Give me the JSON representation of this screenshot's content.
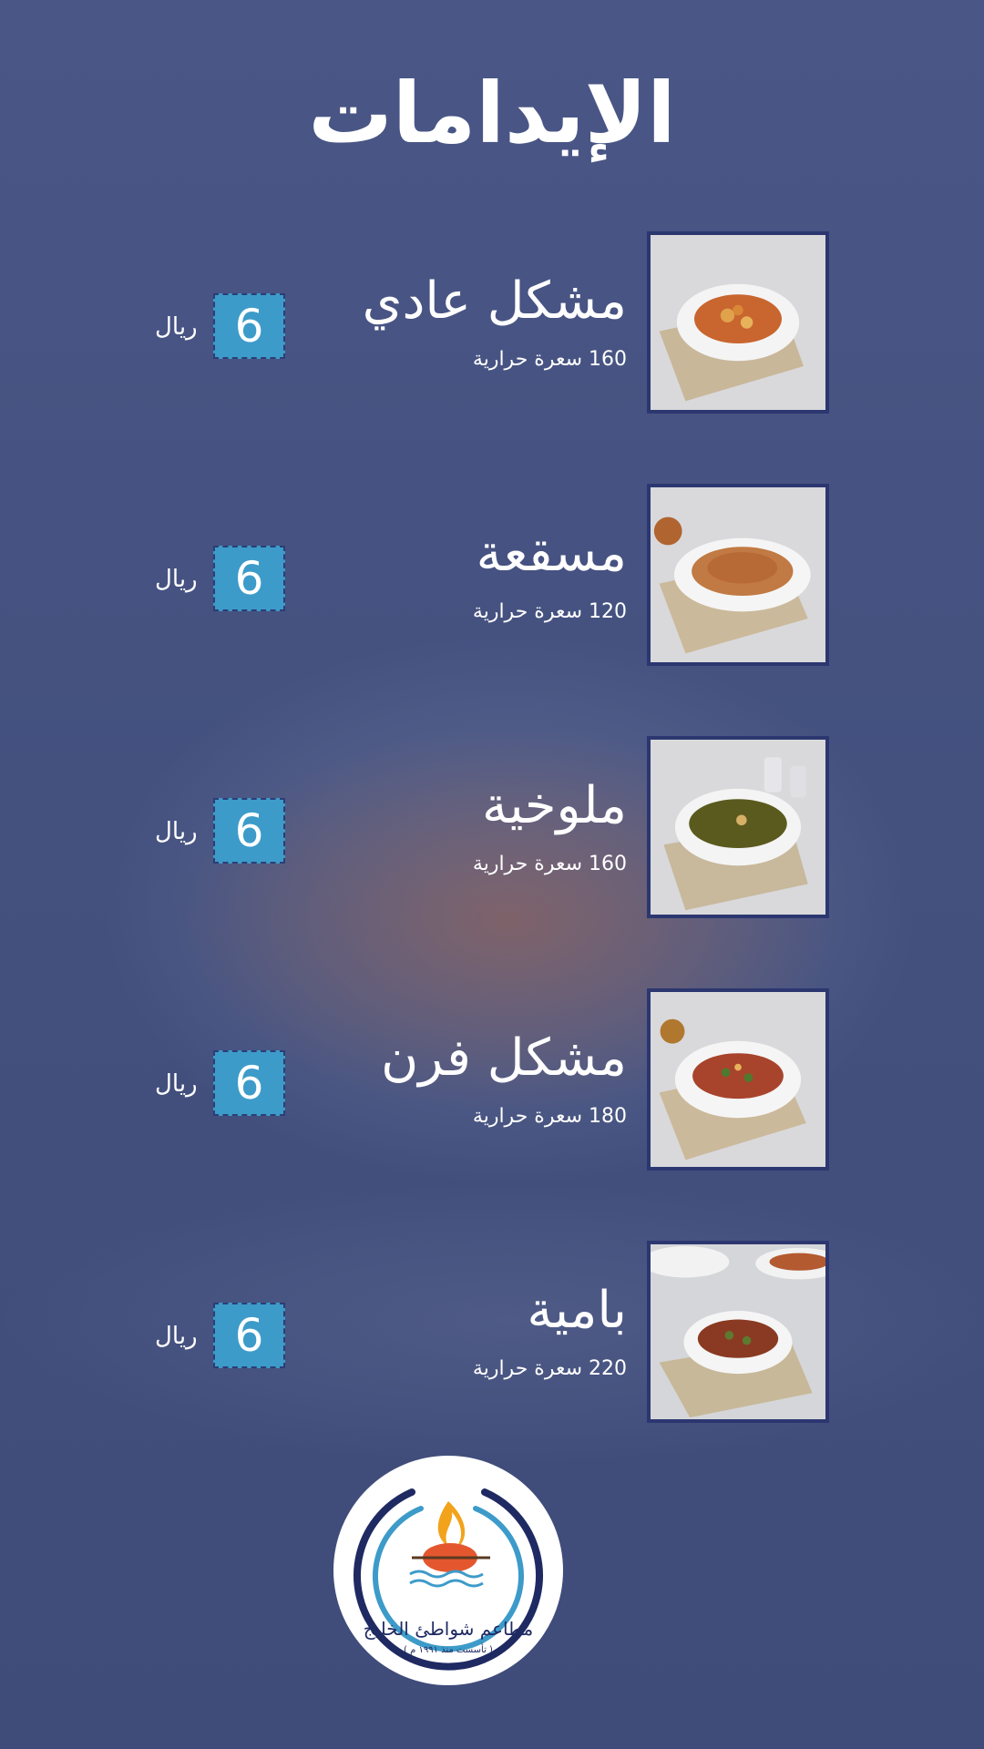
{
  "title": "الإيدامات",
  "items": [
    {
      "name": "مشكل عادي",
      "calories": "160 سعرة حرارية",
      "price": "6",
      "currency": "ريال",
      "dish": "vegetable-stew-bowl"
    },
    {
      "name": "مسقعة",
      "calories": "120 سعرة حرارية",
      "price": "6",
      "currency": "ريال",
      "dish": "moussaka-plate"
    },
    {
      "name": "ملوخية",
      "calories": "160 سعرة حرارية",
      "price": "6",
      "currency": "ريال",
      "dish": "molokhia-bowl"
    },
    {
      "name": "مشكل فرن",
      "calories": "180 سعرة حرارية",
      "price": "6",
      "currency": "ريال",
      "dish": "baked-vegetables-plate"
    },
    {
      "name": "بامية",
      "calories": "220 سعرة حرارية",
      "price": "6",
      "currency": "ريال",
      "dish": "okra-stew-bowl"
    }
  ],
  "logo": {
    "name": "مطاعم شواطئ الخليج",
    "tagline": "( تأسست منذ ١٩٩١ م )",
    "icon": "roast-chicken-flame-icon"
  },
  "colors": {
    "background": "#43507f",
    "price_box": "#3d9bc9",
    "frame": "#2c3770",
    "logo_ring_dark": "#1f2a63",
    "logo_ring_light": "#3d9bc9"
  }
}
